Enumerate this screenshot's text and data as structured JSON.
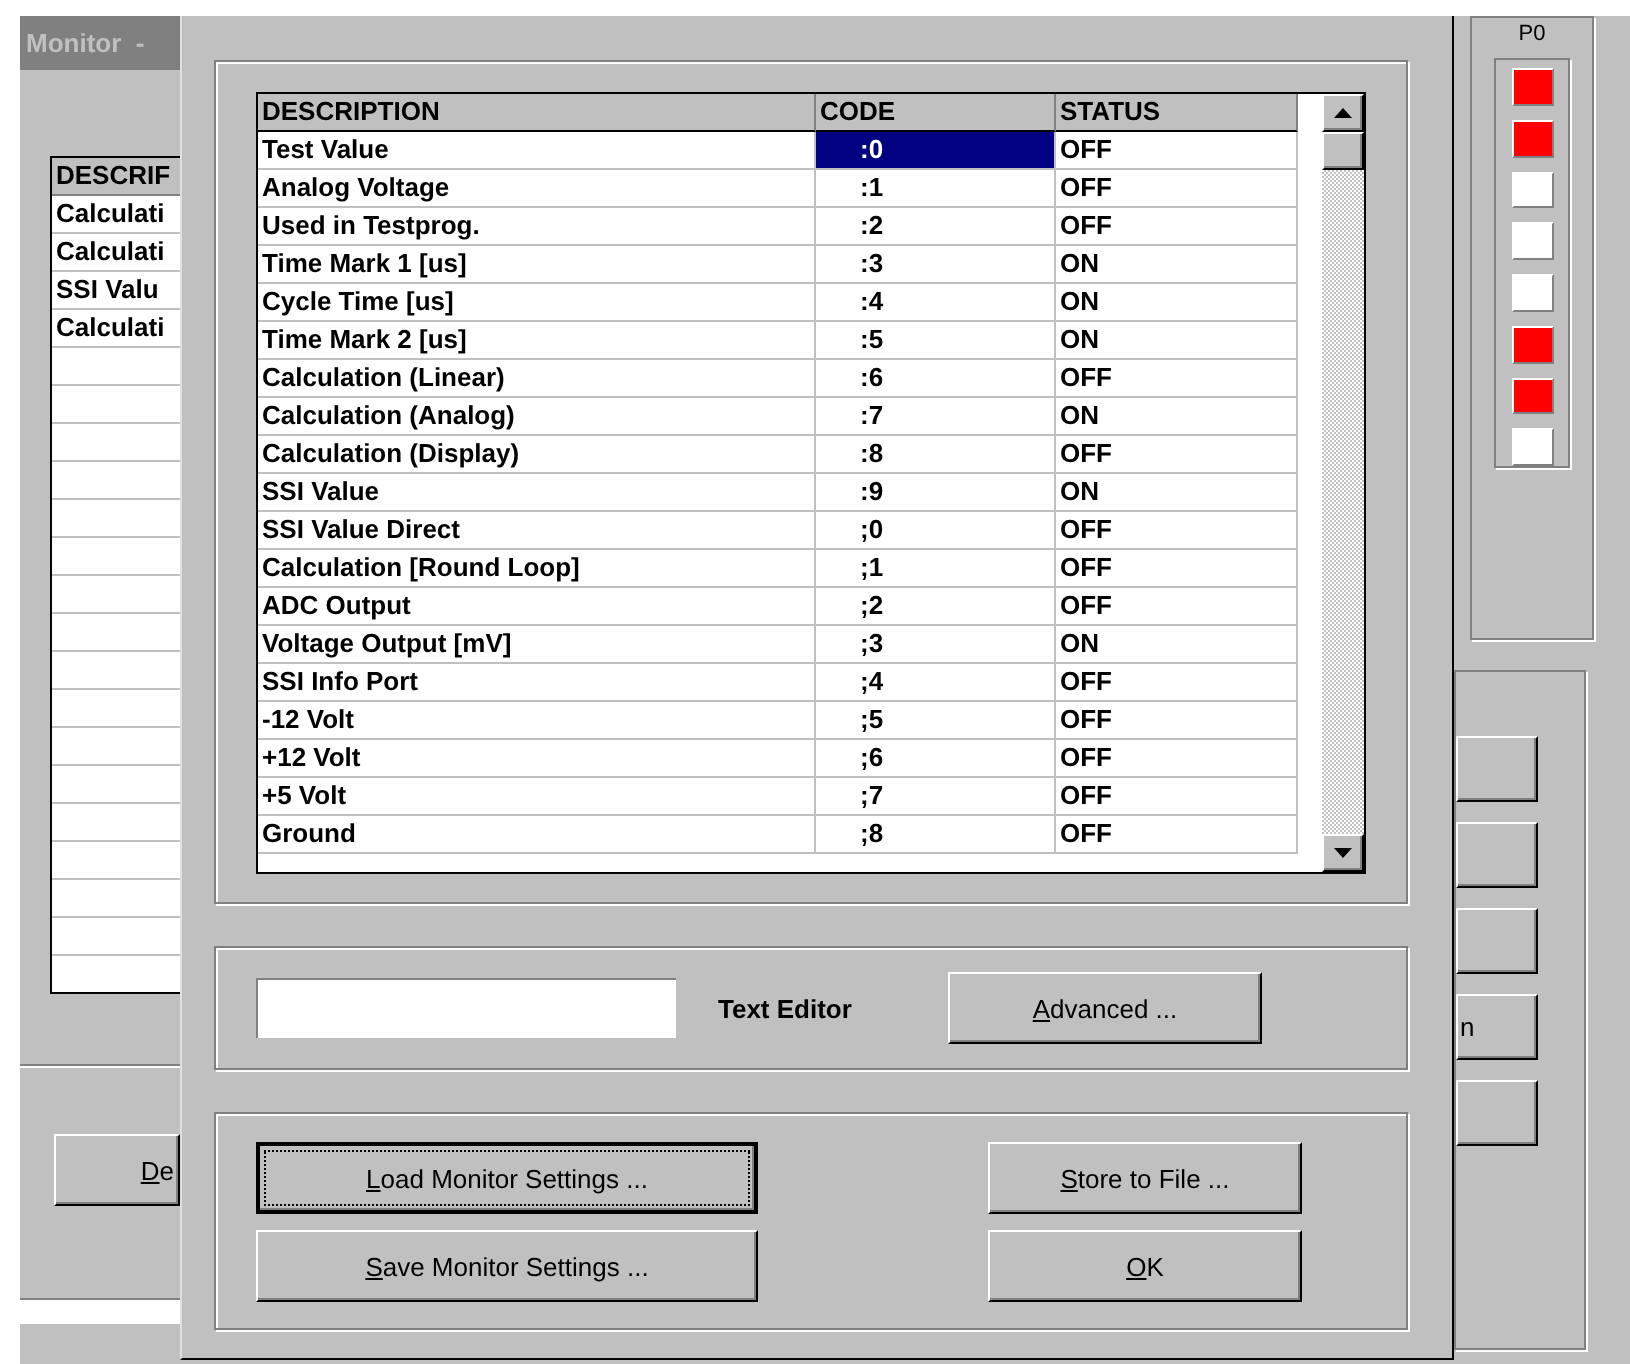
{
  "background_window": {
    "title": "Monitor  -",
    "table": {
      "header": "DESCRIF",
      "rows": [
        "Calculati",
        "Calculati",
        "SSI Valu",
        "Calculati"
      ]
    },
    "button": {
      "label": "De",
      "first_letter_underlined": true
    },
    "port_panel": {
      "title": "P0",
      "leds": [
        {
          "on": true
        },
        {
          "on": true
        },
        {
          "on": false
        },
        {
          "on": false
        },
        {
          "on": false
        },
        {
          "on": true
        },
        {
          "on": true
        },
        {
          "on": false
        }
      ]
    },
    "side_buttons": [
      {
        "kind": "blank"
      },
      {
        "kind": "blank"
      },
      {
        "kind": "blank"
      },
      {
        "kind": "labeled",
        "label": "n"
      },
      {
        "kind": "blank"
      }
    ]
  },
  "dialog": {
    "table": {
      "columns": [
        "DESCRIPTION",
        "CODE",
        "STATUS"
      ],
      "rows": [
        {
          "description": "Test Value",
          "code": ":0",
          "status": "OFF",
          "selected": true
        },
        {
          "description": "Analog Voltage",
          "code": ":1",
          "status": "OFF",
          "selected": false
        },
        {
          "description": "Used in Testprog.",
          "code": ":2",
          "status": "OFF",
          "selected": false
        },
        {
          "description": "Time Mark 1 [us]",
          "code": ":3",
          "status": "ON",
          "selected": false
        },
        {
          "description": "Cycle Time [us]",
          "code": ":4",
          "status": "ON",
          "selected": false
        },
        {
          "description": "Time Mark 2 [us]",
          "code": ":5",
          "status": "ON",
          "selected": false
        },
        {
          "description": "Calculation (Linear)",
          "code": ":6",
          "status": "OFF",
          "selected": false
        },
        {
          "description": "Calculation (Analog)",
          "code": ":7",
          "status": "ON",
          "selected": false
        },
        {
          "description": "Calculation (Display)",
          "code": ":8",
          "status": "OFF",
          "selected": false
        },
        {
          "description": "SSI Value",
          "code": ":9",
          "status": "ON",
          "selected": false
        },
        {
          "description": "SSI Value Direct",
          "code": ";0",
          "status": "OFF",
          "selected": false
        },
        {
          "description": "Calculation [Round Loop]",
          "code": ";1",
          "status": "OFF",
          "selected": false
        },
        {
          "description": "ADC Output",
          "code": ";2",
          "status": "OFF",
          "selected": false
        },
        {
          "description": "Voltage Output [mV]",
          "code": ";3",
          "status": "ON",
          "selected": false
        },
        {
          "description": "SSI Info Port",
          "code": ";4",
          "status": "OFF",
          "selected": false
        },
        {
          "description": "-12 Volt",
          "code": ";5",
          "status": "OFF",
          "selected": false
        },
        {
          "description": "+12 Volt",
          "code": ";6",
          "status": "OFF",
          "selected": false
        },
        {
          "description": "+5 Volt",
          "code": ";7",
          "status": "OFF",
          "selected": false
        },
        {
          "description": "Ground",
          "code": ";8",
          "status": "OFF",
          "selected": false
        }
      ]
    },
    "text_editor": {
      "label": "Text Editor"
    },
    "advanced_button": {
      "label": "Advanced ...",
      "first_letter_underlined": true
    },
    "buttons": [
      {
        "label": "Load Monitor Settings ...",
        "first_letter_underlined": true,
        "focused": true
      },
      {
        "label": "Store to File ...",
        "first_letter_underlined": true,
        "focused": false
      },
      {
        "label": "Save Monitor Settings ...",
        "first_letter_underlined": true,
        "focused": false
      },
      {
        "label": "OK",
        "first_letter_underlined": true,
        "focused": false
      }
    ]
  }
}
